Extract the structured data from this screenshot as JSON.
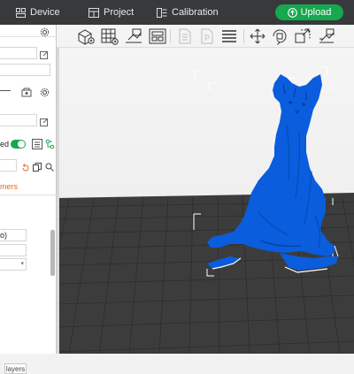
{
  "titlebar": {
    "tabs": [
      {
        "label": "Device",
        "icon": "device-icon"
      },
      {
        "label": "Project",
        "icon": "project-icon"
      },
      {
        "label": "Calibration",
        "icon": "calibration-icon"
      }
    ],
    "upload_label": "Upload"
  },
  "toolbar": {
    "tools": [
      "add-cube-icon",
      "arrange-grid-icon",
      "orient-icon",
      "layout-icon",
      "copy-icon",
      "paste-icon",
      "layers-list-icon",
      "move-icon",
      "rotate-icon",
      "scale-icon",
      "support-paint-icon"
    ]
  },
  "sidebar": {
    "toggle_text_fragment": "ed",
    "filament_text_fragment": "mers",
    "field_value_fragment": "o)",
    "layers_button_label": "layers"
  },
  "colors": {
    "accent": "#15a84e",
    "titlebar_bg": "#37393b",
    "model_blue": "#0a5ddc",
    "plate_dark": "#3c3c3c",
    "filament_orange": "#e06a27"
  }
}
